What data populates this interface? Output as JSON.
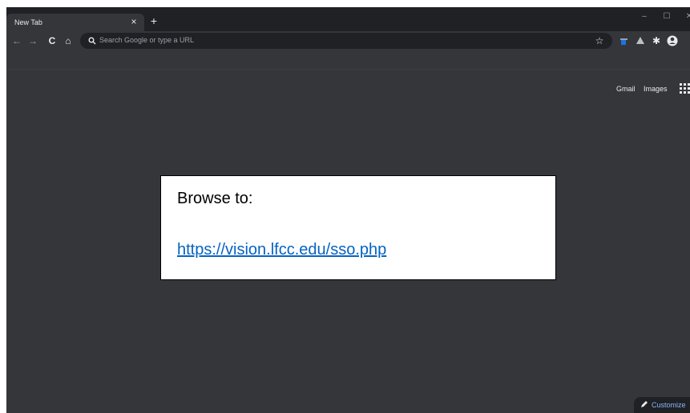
{
  "tab": {
    "title": "New Tab",
    "close_icon": "×",
    "new_tab_icon": "+"
  },
  "window_controls": {
    "minimize": "–",
    "maximize": "☐",
    "close": "✕"
  },
  "toolbar": {
    "back_icon": "←",
    "forward_icon": "→",
    "reload_icon": "C",
    "home_icon": "⌂",
    "omnibox_placeholder": "Search Google or type a URL",
    "bookmark_star": "☆",
    "extensions_icon": "✱",
    "profile_icon": "●"
  },
  "ntp": {
    "gmail_link": "Gmail",
    "images_link": "Images",
    "customize_label": "Customize"
  },
  "callout": {
    "heading": "Browse to:",
    "link": "https://vision.lfcc.edu/sso.php"
  },
  "colors": {
    "frame": "#202124",
    "toolbar": "#35363a",
    "page_bg": "#35363a",
    "link_blue": "#0563c1",
    "accent_blue": "#8ab4f8"
  }
}
